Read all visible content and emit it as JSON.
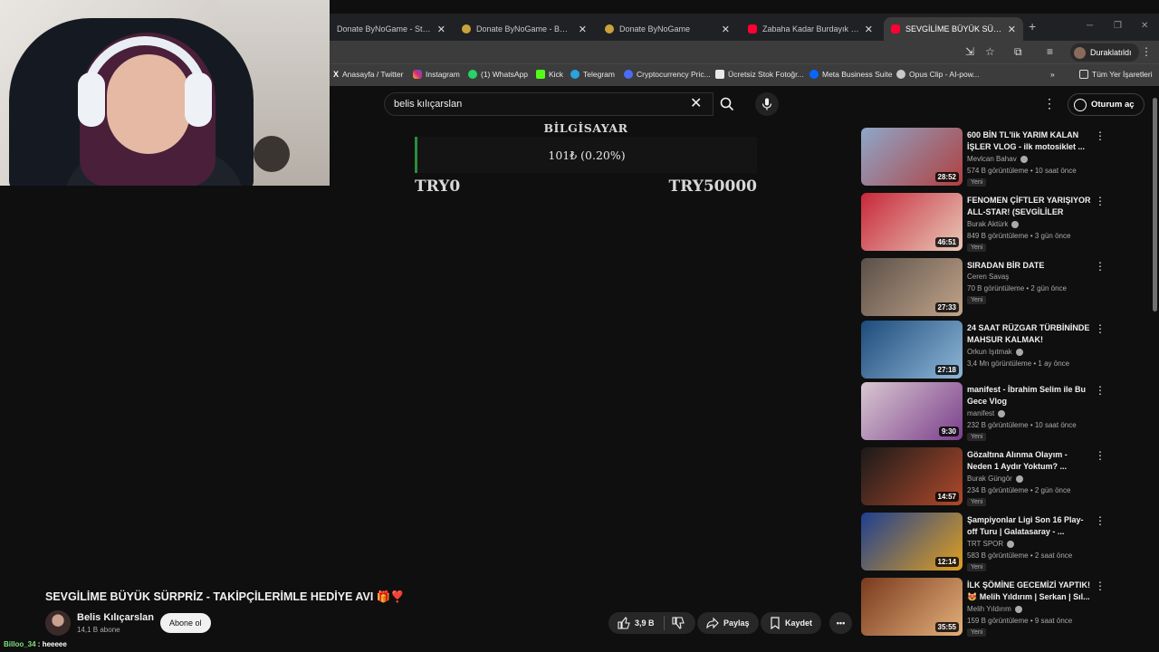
{
  "browser": {
    "tabs": [
      {
        "title": "Donate ByNoGame - Streamer",
        "favicon": "bynogame-icon",
        "active": false
      },
      {
        "title": "Donate ByNoGame - BNG Streamer",
        "favicon": "bynogame-icon",
        "active": false
      },
      {
        "title": "Donate ByNoGame",
        "favicon": "bynogame-icon",
        "active": false
      },
      {
        "title": "Zabaha Kadar Burdayık Bugün",
        "favicon": "youtube-icon",
        "active": false
      },
      {
        "title": "SEVGİLİME BÜYÜK SÜRPRİZ - TAKİPÇİLERİMLE",
        "favicon": "youtube-icon",
        "active": true
      }
    ],
    "profile_label": "Duraklatıldı",
    "bookmarks": [
      {
        "label": "Anasayfa / Twitter",
        "icon": "x-icon"
      },
      {
        "label": "Instagram",
        "icon": "instagram-icon"
      },
      {
        "label": "(1) WhatsApp",
        "icon": "whatsapp-icon"
      },
      {
        "label": "Kick",
        "icon": "kick-icon"
      },
      {
        "label": "Telegram",
        "icon": "telegram-icon"
      },
      {
        "label": "Cryptocurrency Pric...",
        "icon": "crypto-icon"
      },
      {
        "label": "Ücretsiz Stok Fotoğr...",
        "icon": "camera-icon"
      },
      {
        "label": "Meta Business Suite",
        "icon": "meta-icon"
      },
      {
        "label": "Opus Clip - AI-pow...",
        "icon": "opus-icon"
      }
    ],
    "all_bookmarks_label": "Tüm Yer İşaretleri"
  },
  "youtube": {
    "search_value": "belis kılıçarslan",
    "signin_label": "Oturum aç"
  },
  "donation_goal": {
    "title": "BİLGİSAYAR",
    "progress_text": "101₺ (0.20%)",
    "progress_fraction": 0.002,
    "min_label": "TRY0",
    "max_label": "TRY50000",
    "fill_color": "#2e8b3a"
  },
  "video": {
    "title": "SEVGİLİME BÜYÜK SÜRPRİZ - TAKİPÇİLERİMLE HEDİYE AVI 🎁❣️",
    "channel": "Belis Kılıçarslan",
    "subscribers": "14,1 B abone",
    "subscribe_label": "Abone ol",
    "likes": "3,9 B",
    "share_label": "Paylaş",
    "save_label": "Kaydet"
  },
  "chat": {
    "user": "Billoo_34",
    "message": " : heeeee"
  },
  "recommendations": [
    {
      "title": "600 BİN TL'lik YARIM KALAN İŞLER VLOG - ilk motosiklet ...",
      "channel": "Mevlcan Bahav",
      "verified": true,
      "meta": "574 B görüntüleme • 10 saat önce",
      "badge": "Yeni",
      "duration": "28:52",
      "thumb_colors": [
        "#8ea7c9",
        "#b04040"
      ]
    },
    {
      "title": "FENOMEN ÇİFTLER YARIŞIYOR ALL-STAR! (SEVGİLİLER GÜNÜ...",
      "channel": "Burak Aktürk",
      "verified": true,
      "meta": "849 B görüntüleme • 3 gün önce",
      "badge": "Yeni",
      "duration": "46:51",
      "thumb_colors": [
        "#c8283a",
        "#e8c9b8"
      ]
    },
    {
      "title": "SIRADAN BİR DATE",
      "channel": "Ceren Savaş",
      "verified": false,
      "meta": "70 B görüntüleme • 2 gün önce",
      "badge": "Yeni",
      "duration": "27:33",
      "thumb_colors": [
        "#5a5048",
        "#c2a48a"
      ]
    },
    {
      "title": "24 SAAT RÜZGAR TÜRBİNİNDE MAHSUR KALMAK!",
      "channel": "Orkun Işıtmak",
      "verified": true,
      "meta": "3,4 Mn görüntüleme • 1 ay önce",
      "badge": "",
      "duration": "27:18",
      "thumb_colors": [
        "#1d4b7a",
        "#8fb7d8"
      ]
    },
    {
      "title": "manifest - İbrahim Selim ile Bu Gece Vlog",
      "channel": "manifest",
      "verified": true,
      "meta": "232 B görüntüleme • 10 saat önce",
      "badge": "Yeni",
      "duration": "9:30",
      "thumb_colors": [
        "#d9c7d1",
        "#7b3f8c"
      ]
    },
    {
      "title": "Gözaltına Alınma Olayım - Neden 1 Aydır Yoktum? ...",
      "channel": "Burak Güngör",
      "verified": true,
      "meta": "234 B görüntüleme • 2 gün önce",
      "badge": "Yeni",
      "duration": "14:57",
      "thumb_colors": [
        "#1a1a1a",
        "#b0492a"
      ]
    },
    {
      "title": "Şampiyonlar Ligi Son 16 Play-off Turu | Galatasaray - ...",
      "channel": "TRT SPOR",
      "verified": true,
      "meta": "583 B görüntüleme • 2 saat önce",
      "badge": "Yeni",
      "duration": "12:14",
      "thumb_colors": [
        "#1e3f8f",
        "#e0a020"
      ]
    },
    {
      "title": "İLK ŞÖMİNE GECEMİZİ YAPTIK! 😻 Melih Yıldırım | Serkan | Sıl...",
      "channel": "Melih Yıldırım",
      "verified": true,
      "meta": "159 B görüntüleme • 9 saat önce",
      "badge": "Yeni",
      "duration": "35:55",
      "thumb_colors": [
        "#7a3a1e",
        "#e3b07a"
      ]
    }
  ]
}
